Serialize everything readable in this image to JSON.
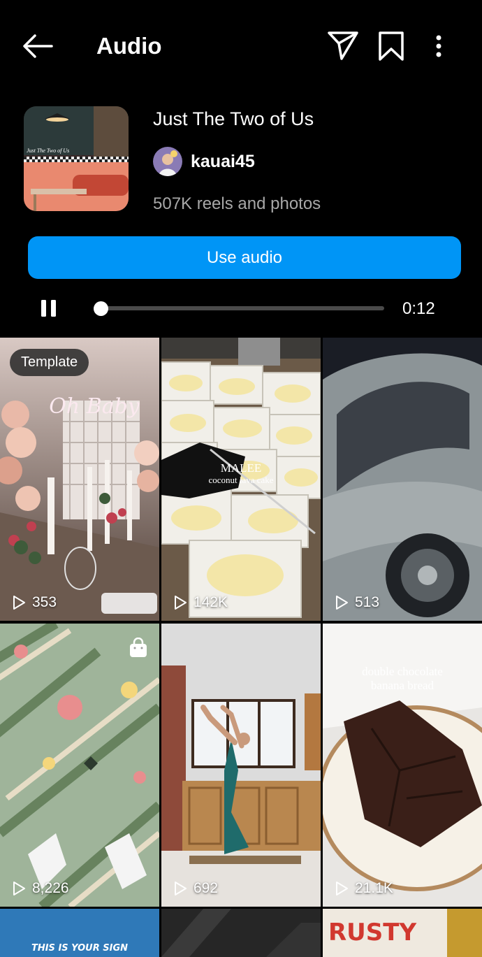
{
  "header": {
    "title": "Audio",
    "icons": [
      "back-arrow-icon",
      "send-icon",
      "bookmark-icon",
      "more-vertical-icon"
    ]
  },
  "audio": {
    "title": "Just The Two of Us",
    "artist": "kauai45",
    "count": "507K reels and photos",
    "cover_text": "Just The Two of Us"
  },
  "actions": {
    "use_audio": "Use audio"
  },
  "player": {
    "time": "0:12",
    "progress": 0.0,
    "state": "playing"
  },
  "grid": {
    "tiles": [
      {
        "plays": "353",
        "badge": "Template",
        "scene": "wedding table with balloons and neon sign",
        "neon": "Oh Baby"
      },
      {
        "plays": "142K",
        "overlay_title": "MALEE",
        "overlay_sub": "coconut lava cake"
      },
      {
        "plays": "513",
        "scene": "vintage car at night"
      },
      {
        "plays": "8,226",
        "icon": "shopping-bag-icon",
        "scene": "patterned rug with sneakers"
      },
      {
        "plays": "692",
        "scene": "yoga stretch in kitchen"
      },
      {
        "plays": "21.1K",
        "overlay_title": "double chocolate",
        "overlay_sub": "banana bread"
      },
      {
        "overlay_title": "THIS IS YOUR SIGN"
      },
      {
        "scene": "dark room"
      },
      {
        "overlay_title": "RUSTY"
      }
    ]
  },
  "colors": {
    "background": "#000000",
    "accent": "#0095f6",
    "secondary_text": "#a8a8a8"
  }
}
